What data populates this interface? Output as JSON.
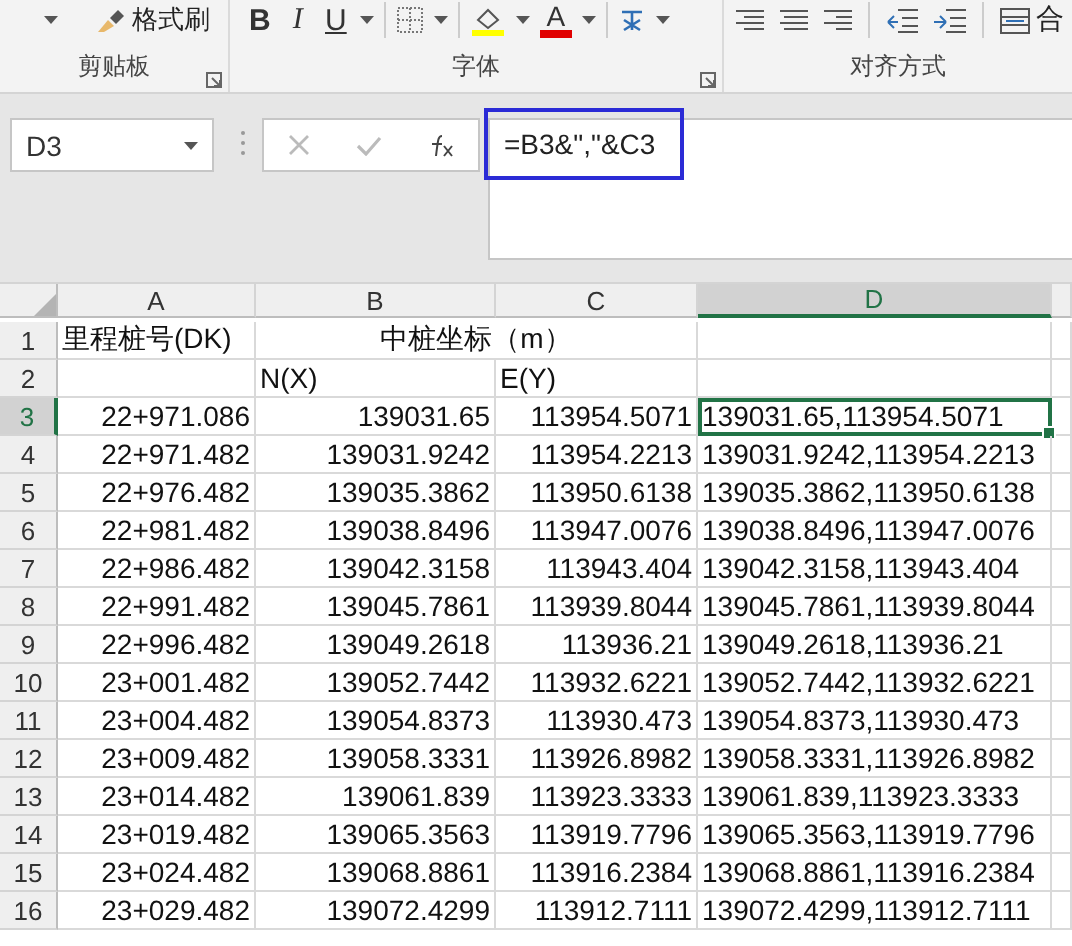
{
  "ribbon": {
    "groups": [
      {
        "kind": "clipboard",
        "label": "剪贴板",
        "items": [
          "格式刷"
        ]
      },
      {
        "kind": "font",
        "label": "字体",
        "items": [
          "B",
          "I",
          "U",
          "A"
        ]
      },
      {
        "kind": "alignment",
        "label": "对齐方式",
        "items": [
          "合"
        ]
      }
    ]
  },
  "formula_bar": {
    "name_box": "D3",
    "formula": "=B3&\",\"&C3"
  },
  "sheet": {
    "columns": [
      {
        "label": "A",
        "selected": false
      },
      {
        "label": "B",
        "selected": false
      },
      {
        "label": "C",
        "selected": false
      },
      {
        "label": "D",
        "selected": true
      }
    ],
    "rows": [
      {
        "label": "1",
        "selected": false,
        "kind": "title",
        "cells": [
          "里程桩号(DK)",
          "中桩坐标（m）"
        ]
      },
      {
        "label": "2",
        "selected": false,
        "kind": "subtitle",
        "cells": [
          "N(X)",
          "E(Y)"
        ]
      },
      {
        "label": "3",
        "selected": true,
        "kind": "data",
        "cells": [
          "22+971.086",
          "139031.65",
          "113954.5071",
          "139031.65,113954.5071"
        ]
      },
      {
        "label": "4",
        "selected": false,
        "kind": "data",
        "cells": [
          "22+971.482",
          "139031.9242",
          "113954.2213",
          "139031.9242,113954.2213"
        ]
      },
      {
        "label": "5",
        "selected": false,
        "kind": "data",
        "cells": [
          "22+976.482",
          "139035.3862",
          "113950.6138",
          "139035.3862,113950.6138"
        ]
      },
      {
        "label": "6",
        "selected": false,
        "kind": "data",
        "cells": [
          "22+981.482",
          "139038.8496",
          "113947.0076",
          "139038.8496,113947.0076"
        ]
      },
      {
        "label": "7",
        "selected": false,
        "kind": "data",
        "cells": [
          "22+986.482",
          "139042.3158",
          "113943.404",
          "139042.3158,113943.404"
        ]
      },
      {
        "label": "8",
        "selected": false,
        "kind": "data",
        "cells": [
          "22+991.482",
          "139045.7861",
          "113939.8044",
          "139045.7861,113939.8044"
        ]
      },
      {
        "label": "9",
        "selected": false,
        "kind": "data",
        "cells": [
          "22+996.482",
          "139049.2618",
          "113936.21",
          "139049.2618,113936.21"
        ]
      },
      {
        "label": "10",
        "selected": false,
        "kind": "data",
        "cells": [
          "23+001.482",
          "139052.7442",
          "113932.6221",
          "139052.7442,113932.6221"
        ]
      },
      {
        "label": "11",
        "selected": false,
        "kind": "data",
        "cells": [
          "23+004.482",
          "139054.8373",
          "113930.473",
          "139054.8373,113930.473"
        ]
      },
      {
        "label": "12",
        "selected": false,
        "kind": "data",
        "cells": [
          "23+009.482",
          "139058.3331",
          "113926.8982",
          "139058.3331,113926.8982"
        ]
      },
      {
        "label": "13",
        "selected": false,
        "kind": "data",
        "cells": [
          "23+014.482",
          "139061.839",
          "113923.3333",
          "139061.839,113923.3333"
        ]
      },
      {
        "label": "14",
        "selected": false,
        "kind": "data",
        "cells": [
          "23+019.482",
          "139065.3563",
          "113919.7796",
          "139065.3563,113919.7796"
        ]
      },
      {
        "label": "15",
        "selected": false,
        "kind": "data",
        "cells": [
          "23+024.482",
          "139068.8861",
          "113916.2384",
          "139068.8861,113916.2384"
        ]
      },
      {
        "label": "16",
        "selected": false,
        "kind": "data",
        "cells": [
          "23+029.482",
          "139072.4299",
          "113912.7111",
          "139072.4299,113912.7111"
        ]
      }
    ]
  }
}
